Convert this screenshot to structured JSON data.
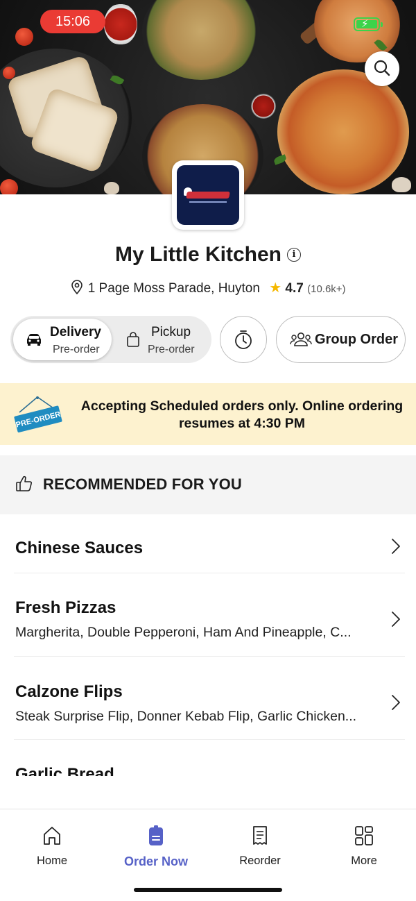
{
  "status_bar": {
    "time": "15:06",
    "battery": "charging"
  },
  "colors": {
    "accent": "#5661c7",
    "banner_bg": "#fdf2cf",
    "star": "#f5b800",
    "time_pill": "#ea3b34",
    "logo_bg": "#0f1d4a"
  },
  "restaurant": {
    "name": "My Little Kitchen",
    "address": "1 Page Moss Parade, Huyton",
    "rating": "4.7",
    "rating_count": "(10.6k+)",
    "logo_text": "My Little Kitchen"
  },
  "order_modes": [
    {
      "label": "Delivery",
      "sub": "Pre-order",
      "selected": true,
      "icon": "car-icon"
    },
    {
      "label": "Pickup",
      "sub": "Pre-order",
      "selected": false,
      "icon": "bag-icon"
    }
  ],
  "schedule_button": {
    "icon": "timer-icon"
  },
  "group_order": {
    "label": "Group Order",
    "icon": "group-icon"
  },
  "banner": {
    "sign_text": "PRE-ORDER",
    "text": "Accepting Scheduled orders only. Online ordering resumes at 4:30 PM"
  },
  "recommended": {
    "label": "RECOMMENDED FOR YOU",
    "icon": "thumbs-up-icon"
  },
  "categories": [
    {
      "name": "Chinese Sauces",
      "desc": ""
    },
    {
      "name": "Fresh Pizzas",
      "desc": "Margherita, Double Pepperoni, Ham And Pineapple, C..."
    },
    {
      "name": "Calzone Flips",
      "desc": "Steak Surprise Flip, Donner Kebab Flip, Garlic Chicken..."
    },
    {
      "name": "Garlic Bread",
      "desc": ""
    }
  ],
  "bottom_nav": [
    {
      "label": "Home",
      "icon": "home-icon",
      "active": false
    },
    {
      "label": "Order Now",
      "icon": "order-icon",
      "active": true
    },
    {
      "label": "Reorder",
      "icon": "receipt-icon",
      "active": false
    },
    {
      "label": "More",
      "icon": "grid-icon",
      "active": false
    }
  ]
}
